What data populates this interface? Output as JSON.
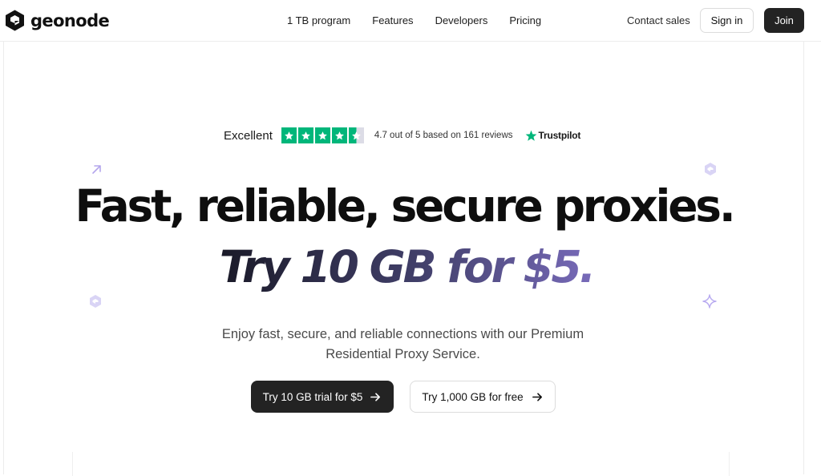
{
  "brand": {
    "name": "geonode"
  },
  "nav": {
    "links": [
      "1 TB program",
      "Features",
      "Developers",
      "Pricing"
    ],
    "contact_sales": "Contact sales",
    "sign_in": "Sign in",
    "join": "Join"
  },
  "trustpilot": {
    "rating_word": "Excellent",
    "stars": 4.5,
    "summary": "4.7 out of 5 based on 161 reviews",
    "brand": "Trustpilot"
  },
  "hero": {
    "headline": "Fast, reliable, secure proxies.",
    "tagline": "Try 10 GB for $5.",
    "subtitle_line1": "Enjoy fast, secure, and reliable connections with our Premium",
    "subtitle_line2": "Residential Proxy Service.",
    "cta_primary": "Try 10 GB trial for $5",
    "cta_secondary": "Try 1,000 GB for free"
  },
  "colors": {
    "accent_purple": "#9b85e8",
    "trustpilot_green": "#00b67a",
    "button_dark": "#232323"
  },
  "icons": [
    "geonode-logo-icon",
    "star-icon",
    "trustpilot-star-icon",
    "arrow-right-icon",
    "arrow-up-right-icon",
    "geonode-hex-icon",
    "sparkle-icon"
  ]
}
